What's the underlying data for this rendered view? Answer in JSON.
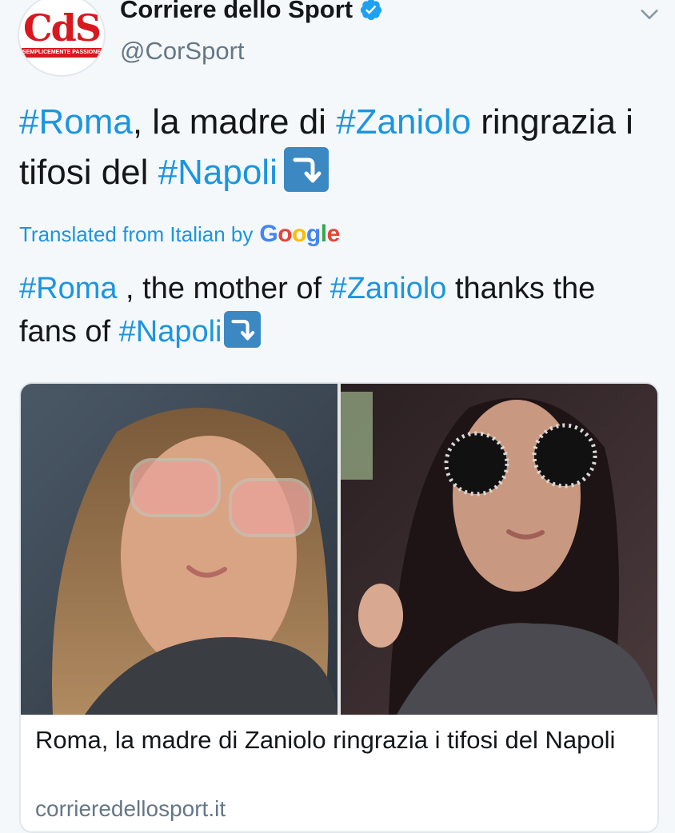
{
  "account": {
    "display_name": "Corriere dello Sport",
    "handle": "@CorSport",
    "avatar_text": "CdS",
    "avatar_tagline": "SEMPLICEMENTE PASSIONE"
  },
  "tweet": {
    "segments": [
      {
        "text": "#Roma",
        "hashtag": true
      },
      {
        "text": ", la madre di ",
        "hashtag": false
      },
      {
        "text": "#Zaniolo",
        "hashtag": true
      },
      {
        "text": " ringrazia i tifosi del ",
        "hashtag": false
      },
      {
        "text": "#Napoli",
        "hashtag": true
      }
    ]
  },
  "translation": {
    "label": "Translated from Italian by",
    "provider": "Google",
    "segments": [
      {
        "text": "#Roma",
        "hashtag": true
      },
      {
        "text": " , the mother of ",
        "hashtag": false
      },
      {
        "text": "#Zaniolo",
        "hashtag": true
      },
      {
        "text": " thanks the fans of ",
        "hashtag": false
      },
      {
        "text": "#Napoli",
        "hashtag": true
      }
    ]
  },
  "card": {
    "title": "Roma, la madre di Zaniolo ringrazia i tifosi del Napoli",
    "domain": "corrieredellosport.it"
  },
  "icons": {
    "verified": "verified-badge-icon",
    "menu": "chevron-down-icon",
    "emoji": "right-arrow-curving-down-emoji"
  },
  "colors": {
    "hashtag": "#1b95e0",
    "verified": "#1da1f2",
    "text": "#14171a",
    "muted": "#657786",
    "brand_red": "#d7191f"
  }
}
